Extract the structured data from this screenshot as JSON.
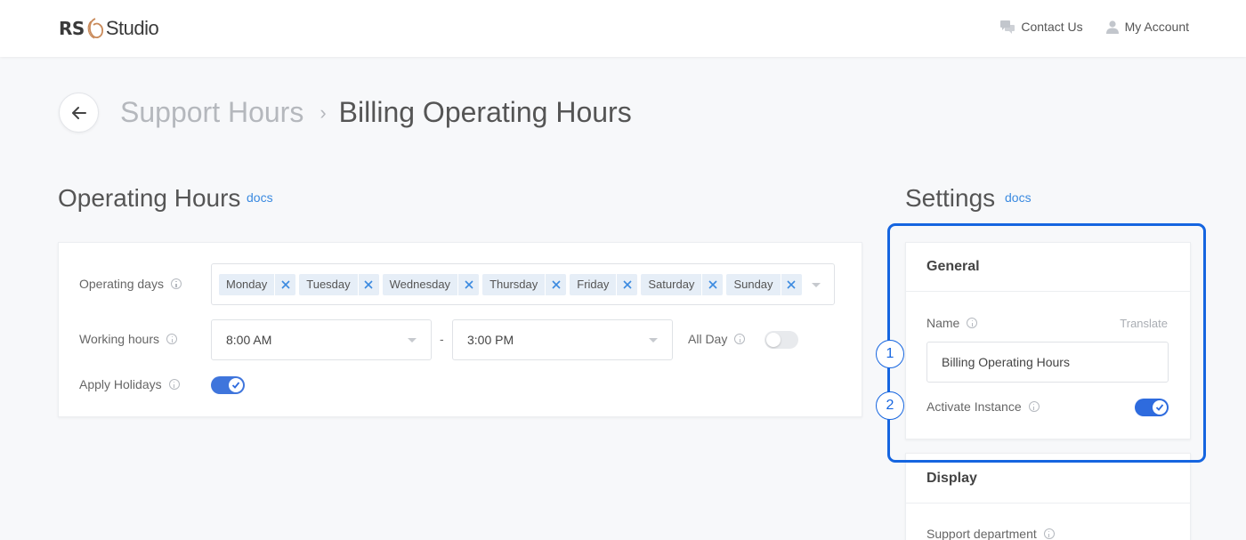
{
  "header": {
    "logo_rs": "RS",
    "logo_studio": "Studio",
    "contact_label": "Contact Us",
    "account_label": "My Account"
  },
  "breadcrumb": {
    "parent": "Support Hours",
    "current": "Billing Operating Hours"
  },
  "operating_hours": {
    "title": "Operating Hours",
    "docs_label": "docs",
    "days_label": "Operating days",
    "days": [
      "Monday",
      "Tuesday",
      "Wednesday",
      "Thursday",
      "Friday",
      "Saturday",
      "Sunday"
    ],
    "working_hours_label": "Working hours",
    "start_time": "8:00 AM",
    "range_separator": "-",
    "end_time": "3:00 PM",
    "all_day_label": "All Day",
    "all_day_enabled": false,
    "apply_holidays_label": "Apply Holidays",
    "apply_holidays_enabled": true
  },
  "settings": {
    "title": "Settings",
    "docs_label": "docs",
    "general": {
      "heading": "General",
      "name_label": "Name",
      "translate_label": "Translate",
      "name_value": "Billing Operating Hours",
      "activate_label": "Activate Instance",
      "activate_enabled": true
    },
    "display": {
      "heading": "Display",
      "support_department_label": "Support department"
    }
  },
  "annotations": {
    "marker_1": "1",
    "marker_2": "2",
    "highlight_color": "#1565e0"
  },
  "colors": {
    "accent": "#2e6bde",
    "link": "#3b8ae0",
    "tag_bg": "#e6eef7"
  }
}
